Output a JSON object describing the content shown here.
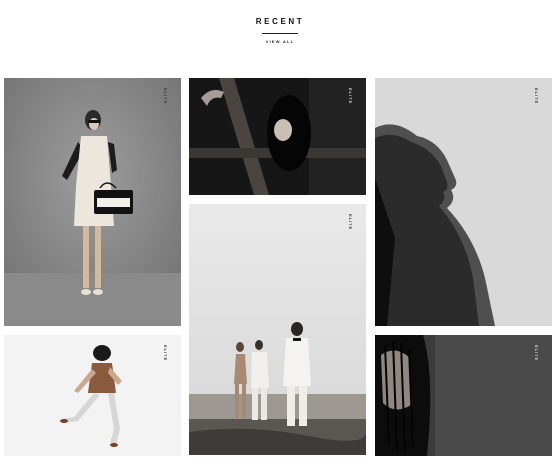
{
  "section": {
    "title": "RECENT",
    "view_all": "VIEW ALL"
  },
  "gallery": {
    "tag": "ELITE",
    "items": [
      {
        "subject": "woman in white dress with handbag"
      },
      {
        "subject": "woman behind wooden beams"
      },
      {
        "subject": "woman profile neck"
      },
      {
        "subject": "leaping woman"
      },
      {
        "subject": "three figures on beach"
      },
      {
        "subject": "woman with wet hair"
      }
    ]
  },
  "colors": {
    "background": "#ffffff",
    "text": "#111111"
  }
}
